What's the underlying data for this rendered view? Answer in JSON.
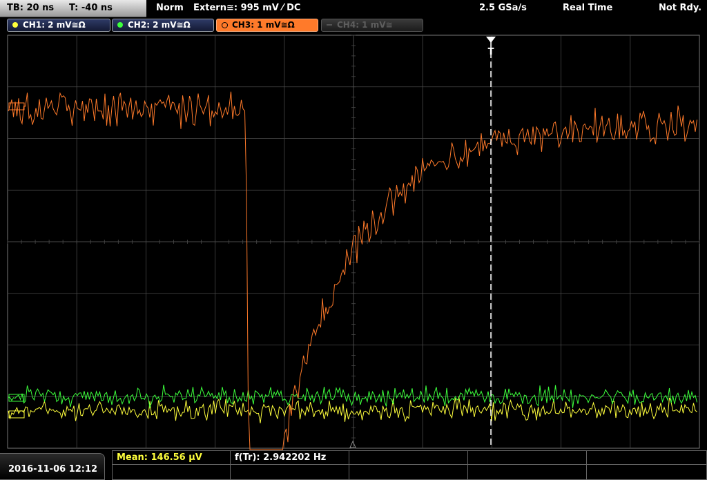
{
  "topbar": {
    "timebase": "TB: 20 ns",
    "trigger_time": "T: -40 ns",
    "mode": "Norm",
    "trigger_source": "Extern≅: 995 mV ⁄ DC",
    "sample_rate": "2.5 GSa/s",
    "acq_mode": "Real Time",
    "state": "Not Rdy."
  },
  "channels": [
    {
      "label": "CH1: 2 mV≅Ω",
      "color": "#ffff3c"
    },
    {
      "label": "CH2: 2 mV≅Ω",
      "color": "#3cff3c"
    },
    {
      "label": "CH3: 1 mV≅Ω",
      "color": "#ff7a2a"
    },
    {
      "label": "CH4: 1 mV≅",
      "color": "#6a6a6a"
    }
  ],
  "trigger_marker": "T",
  "measurements": {
    "mean": "Mean: 146.56 µV",
    "freq": "f(Tr): 2.942202 Hz"
  },
  "datetime": "2016-11-06 12:12",
  "colors": {
    "grid": "#4a4a4a",
    "ch1": "#ffff3c",
    "ch2": "#3cff3c",
    "ch3": "#ff7a2a"
  }
}
